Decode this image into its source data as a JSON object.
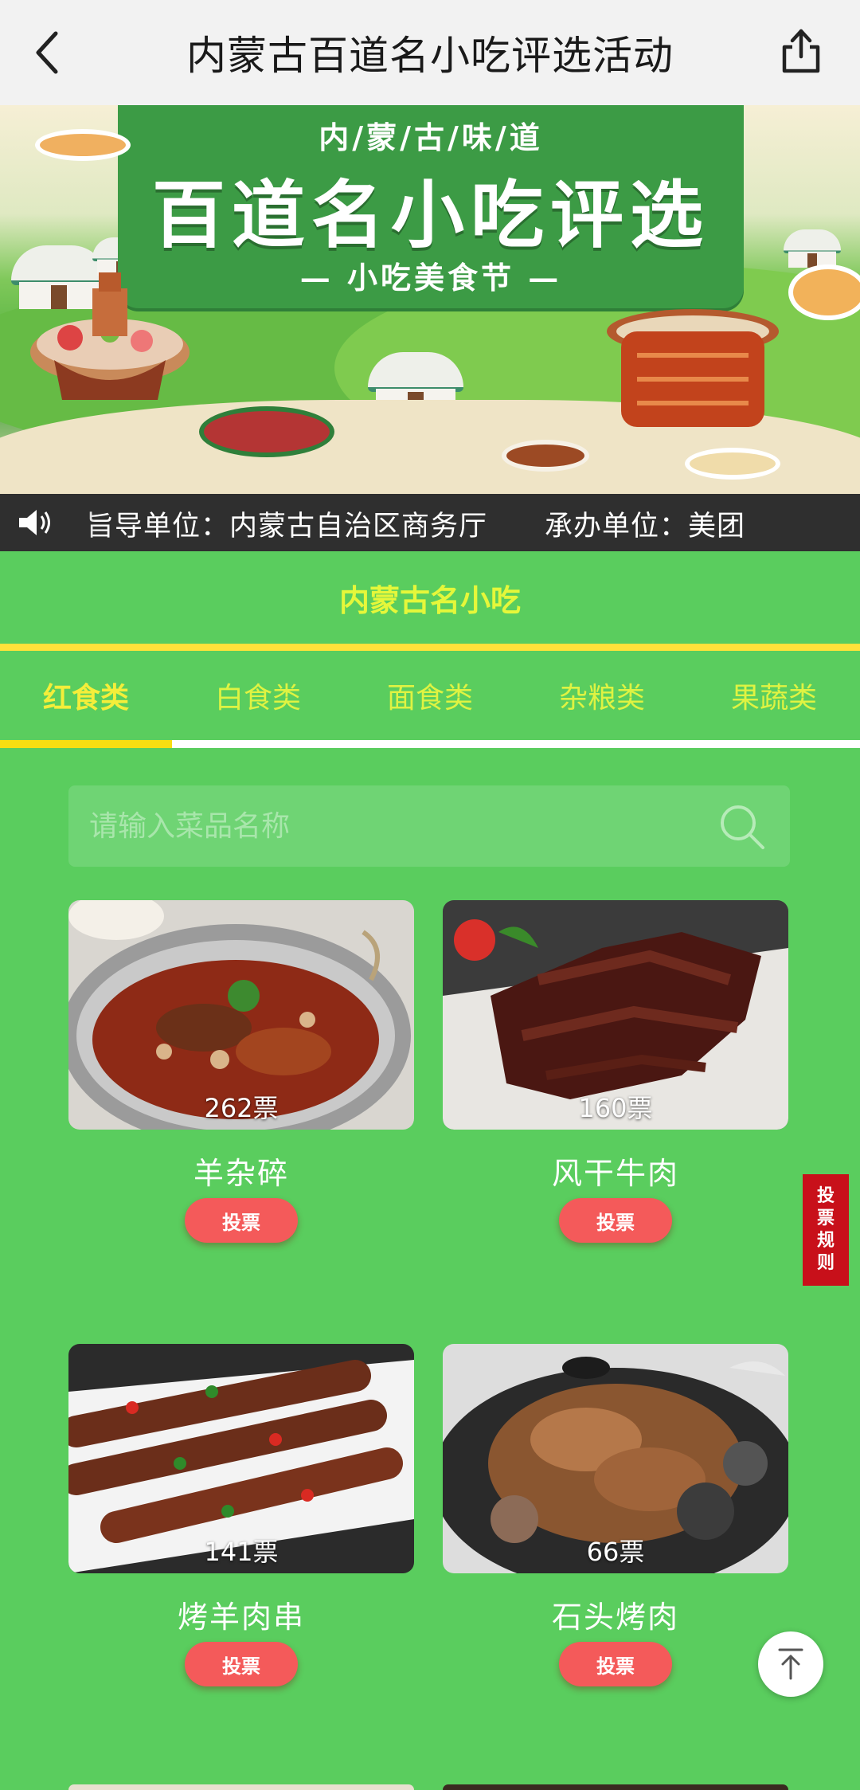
{
  "header": {
    "title": "内蒙古百道名小吃评选活动",
    "back_icon": "chevron-left-icon",
    "share_icon": "share-icon"
  },
  "banner": {
    "subtitle": "内/蒙/古/味/道",
    "title": "百道名小吃评选",
    "tagline": "— 小吃美食节 —"
  },
  "marquee": {
    "icon": "speaker-icon",
    "text": "指导单位：内蒙古自治区商务厅　　承办单位：美团",
    "visible_text": "旨导单位：内蒙古自治区商务厅　　承办单位：美团"
  },
  "section": {
    "title": "内蒙古名小吃"
  },
  "tabs": [
    {
      "label": "红食类",
      "active": true
    },
    {
      "label": "白食类",
      "active": false
    },
    {
      "label": "面食类",
      "active": false
    },
    {
      "label": "杂粮类",
      "active": false
    },
    {
      "label": "果蔬类",
      "active": false
    }
  ],
  "search": {
    "placeholder": "请输入菜品名称",
    "value": ""
  },
  "dishes": [
    {
      "name": "羊杂碎",
      "votes": "262票",
      "button": "投票"
    },
    {
      "name": "风干牛肉",
      "votes": "160票",
      "button": "投票"
    },
    {
      "name": "烤羊肉串",
      "votes": "141票",
      "button": "投票"
    },
    {
      "name": "石头烤肉",
      "votes": "66票",
      "button": "投票"
    }
  ],
  "rules_tab": {
    "chars": [
      "投",
      "票",
      "规",
      "则"
    ]
  },
  "colors": {
    "page_bg": "#5acd5e",
    "accent_yellow": "#f6de12",
    "vote_red": "#f45a5a",
    "rules_red": "#c8101a"
  }
}
